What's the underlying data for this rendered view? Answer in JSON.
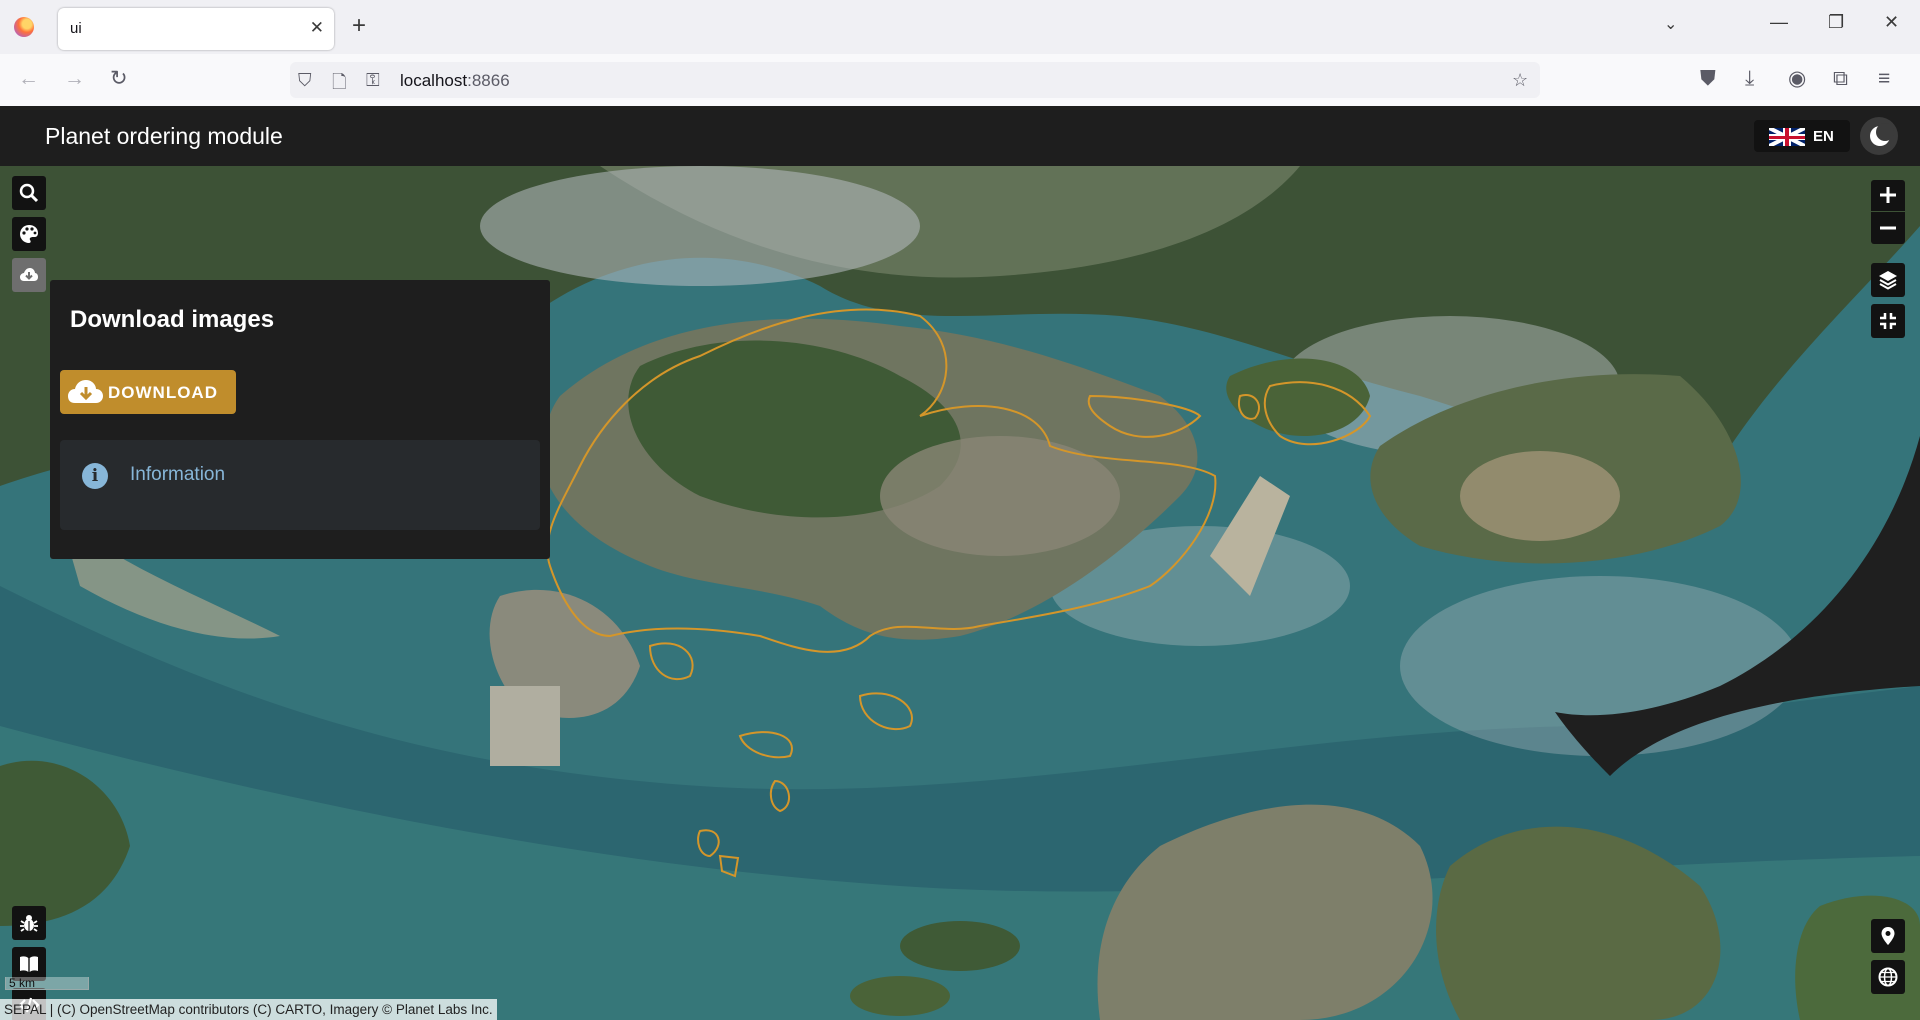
{
  "browser": {
    "tab_title": "ui",
    "url_host": "localhost",
    "url_port": ":8866"
  },
  "app": {
    "title": "Planet ordering module",
    "language": "EN"
  },
  "panel": {
    "title": "Download images",
    "download_label": "DOWNLOAD",
    "info_label": "Information"
  },
  "map": {
    "scale_label": "5 km",
    "attribution": "SEPAL | (C) OpenStreetMap contributors (C) CARTO, Imagery © Planet Labs Inc.",
    "aoi_outline_color": "#d4962a"
  },
  "icons": {
    "left_top": [
      "search-icon",
      "palette-icon",
      "cloud-download-icon"
    ],
    "left_bottom": [
      "bug-icon",
      "book-icon",
      "code-icon"
    ],
    "right_top": [
      "zoom-in-icon",
      "zoom-out-icon",
      "layers-icon",
      "fullscreen-exit-icon"
    ],
    "right_bottom": [
      "map-marker-icon",
      "globe-icon"
    ]
  }
}
